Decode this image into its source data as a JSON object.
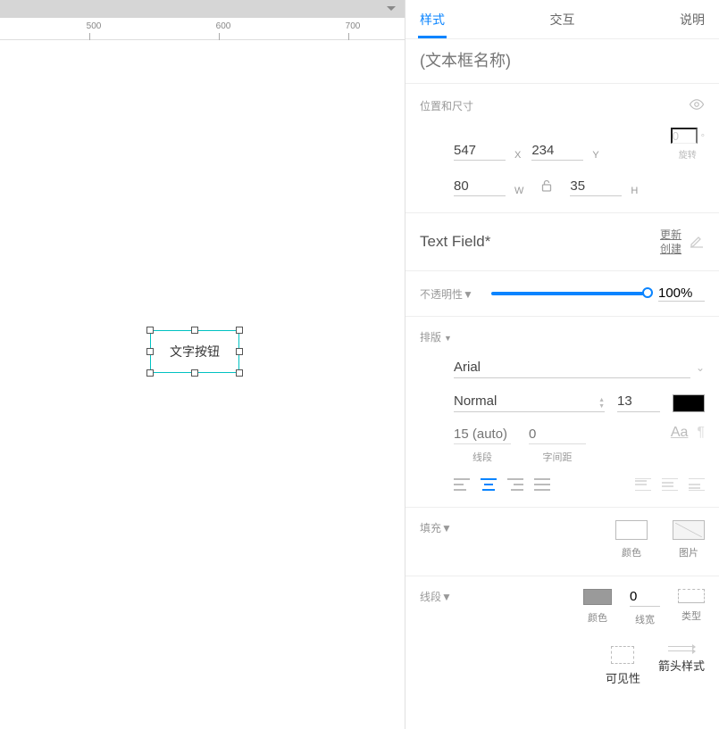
{
  "ruler": {
    "ticks": [
      "500",
      "600",
      "700"
    ]
  },
  "canvas": {
    "widget_label": "文字按钮"
  },
  "tabs": {
    "style": "样式",
    "interaction": "交互",
    "notes": "说明"
  },
  "name_placeholder": "(文本框名称)",
  "position": {
    "header": "位置和尺寸",
    "x": "547",
    "x_label": "X",
    "y": "234",
    "y_label": "Y",
    "rot": "0",
    "rot_label": "旋转",
    "w": "80",
    "w_label": "W",
    "h": "35",
    "h_label": "H"
  },
  "component": {
    "name": "Text Field*",
    "update": "更新",
    "create": "创建"
  },
  "opacity": {
    "label": "不透明性",
    "value": "100%"
  },
  "typography": {
    "header": "排版",
    "font": "Arial",
    "weight": "Normal",
    "size": "13",
    "line_height_placeholder": "15 (auto)",
    "letter_spacing_placeholder": "0",
    "line_height_label": "线段",
    "letter_spacing_label": "字间距",
    "case_label": "Aa"
  },
  "fill": {
    "header": "填充",
    "color_label": "颜色",
    "image_label": "图片"
  },
  "line": {
    "header": "线段",
    "color_label": "颜色",
    "width_value": "0",
    "width_label": "线宽",
    "type_label": "类型",
    "visibility_label": "可见性",
    "arrow_label": "箭头样式"
  }
}
